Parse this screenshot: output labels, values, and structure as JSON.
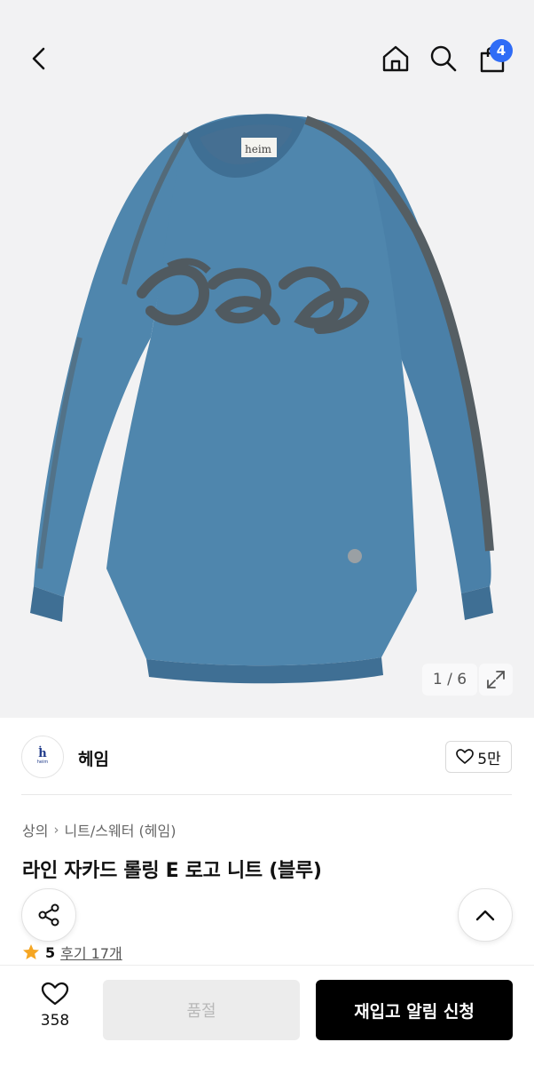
{
  "header": {
    "back_icon": "chevron-left-icon",
    "home_icon": "home-icon",
    "search_icon": "search-icon",
    "cart_icon": "shopping-bag-icon",
    "cart_count": "4",
    "badge_color": "#2f6cf6"
  },
  "gallery": {
    "counter": "1 / 6",
    "expand_icon": "expand-icon",
    "image_subject": "blue knit sweater with logo",
    "label_text": "heim",
    "sweater_color": "#4f86ad",
    "logo_color": "#505a60"
  },
  "brand": {
    "name": "헤임",
    "logo_mark": "ḣ",
    "logo_word": "heim",
    "like_count": "5만",
    "logo_color": "#1f3a8a"
  },
  "product": {
    "breadcrumb": [
      "상의",
      "니트/스웨터 (헤임)"
    ],
    "title": "라인 자카드 롤링 E 로고 니트 (블루)",
    "rating": "5",
    "review_link": "후기 17개",
    "star_color": "#f5a623"
  },
  "actions": {
    "wish_count": "358",
    "soldout_label": "품절",
    "restock_label": "재입고 알림 신청"
  }
}
